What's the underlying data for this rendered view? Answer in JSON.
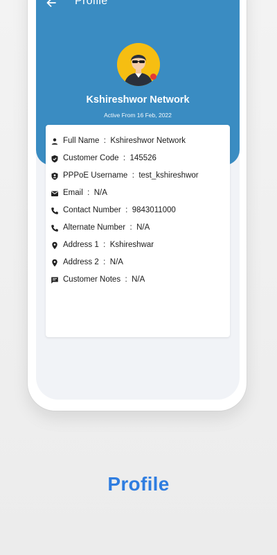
{
  "header": {
    "title": "Profile",
    "back_icon": "arrow-left-icon"
  },
  "profile": {
    "name": "Kshireshwor Network",
    "active_from": "Active From 16 Feb, 2022",
    "avatar_icon": "user-avatar-icon",
    "status_dot_color": "#e53935"
  },
  "details": [
    {
      "icon": "person-icon",
      "label": "Full Name",
      "sep": "  :  ",
      "value": "Kshireshwor Network"
    },
    {
      "icon": "shield-check-icon",
      "label": "Customer Code",
      "sep": "  :  ",
      "value": "145526"
    },
    {
      "icon": "person-shield-icon",
      "label": "PPPoE Username",
      "sep": "  :  ",
      "value": "test_kshireshwor"
    },
    {
      "icon": "mail-icon",
      "label": "Email",
      "sep": "  :  ",
      "value": "N/A"
    },
    {
      "icon": "phone-icon",
      "label": "Contact Number",
      "sep": "  :  ",
      "value": "9843011000"
    },
    {
      "icon": "phone-icon",
      "label": "Alternate Number",
      "sep": "  :  ",
      "value": "N/A"
    },
    {
      "icon": "location-pin-icon",
      "label": "Address 1",
      "sep": "  :  ",
      "value": "Kshireshwar"
    },
    {
      "icon": "location-pin-icon",
      "label": "Address 2",
      "sep": "  :  ",
      "value": "N/A"
    },
    {
      "icon": "chat-note-icon",
      "label": "Customer Notes",
      "sep": "  :  ",
      "value": "N/A"
    }
  ],
  "caption": "Profile",
  "colors": {
    "header_blue": "#3a8cc2",
    "caption_blue": "#2f7de0",
    "avatar_yellow": "#f6be12"
  }
}
